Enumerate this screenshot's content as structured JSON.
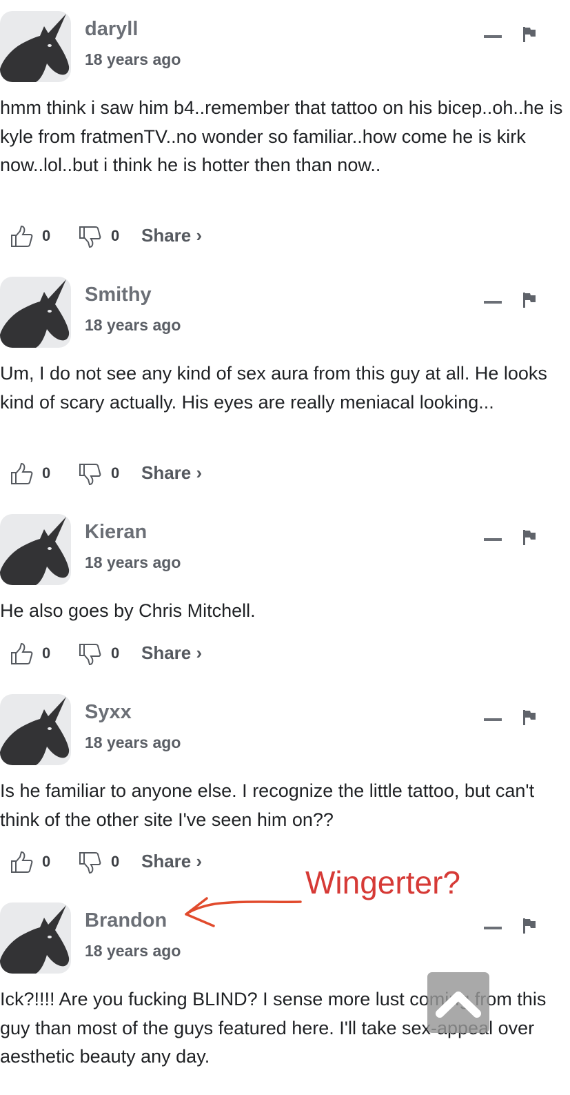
{
  "comments": [
    {
      "author": "daryll",
      "time": "18 years ago",
      "text": "hmm think i saw him b4..remember that tattoo on his bicep..oh..he is kyle from fratmenTV..no wonder so familiar..how come he is kirk now..lol..but i think he is hotter then than now..",
      "likes": "0",
      "dislikes": "0",
      "share": "Share ›"
    },
    {
      "author": "Smithy",
      "time": "18 years ago",
      "text": "Um, I do not see any kind of sex aura from this guy at all. He looks kind of scary actually. His eyes are really meniacal looking...",
      "likes": "0",
      "dislikes": "0",
      "share": "Share ›"
    },
    {
      "author": "Kieran",
      "time": "18 years ago",
      "text": "He also goes by Chris Mitchell.",
      "likes": "0",
      "dislikes": "0",
      "share": "Share ›"
    },
    {
      "author": "Syxx",
      "time": "18 years ago",
      "text": "Is he familiar to anyone else. I recognize the little tattoo, but can't think of the other site I've seen him on??",
      "likes": "0",
      "dislikes": "0",
      "share": "Share ›"
    },
    {
      "author": "Brandon",
      "time": "18 years ago",
      "text": "Ick?!!!! Are you fucking BLIND? I sense more lust coming from this guy than most of the guys featured here. I'll take sex-appeal over aesthetic beauty any day."
    }
  ],
  "annotation": {
    "text": "Wingerter?",
    "color": "#d63a36"
  },
  "icons": {
    "avatar": "unicorn-avatar-icon",
    "collapse": "minus-icon",
    "flag": "flag-icon",
    "like": "thumbs-up-icon",
    "dislike": "thumbs-down-icon",
    "scroll_top": "chevron-up-icon"
  }
}
